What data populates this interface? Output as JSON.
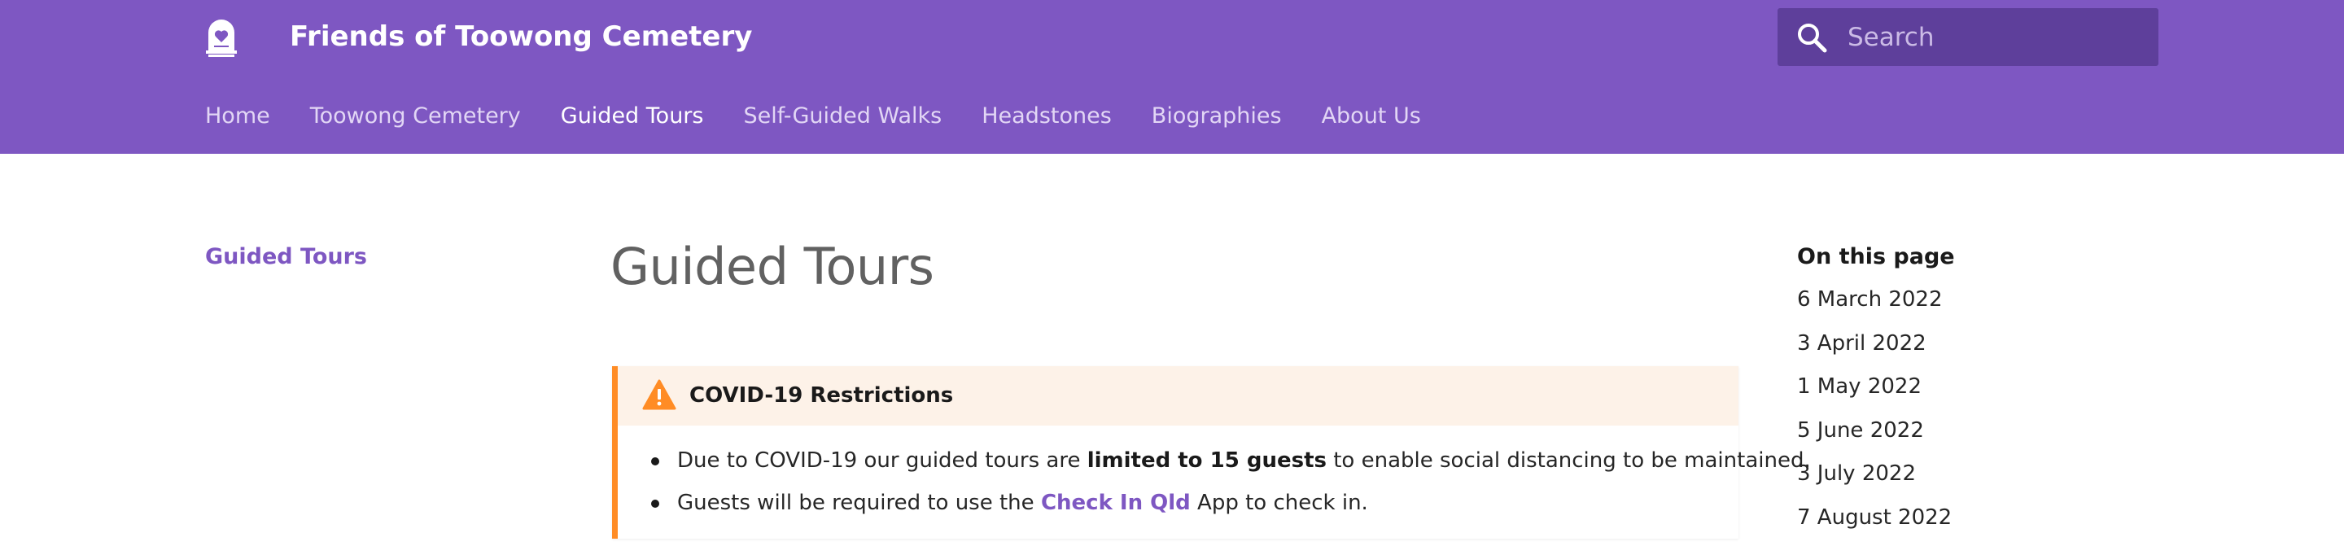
{
  "site": {
    "title": "Friends of Toowong Cemetery",
    "logo_icon": "headstone-heart-icon"
  },
  "search": {
    "placeholder": "Search",
    "value": "",
    "icon": "search-icon"
  },
  "nav": {
    "items": [
      {
        "label": "Home",
        "active": false
      },
      {
        "label": "Toowong Cemetery",
        "active": false
      },
      {
        "label": "Guided Tours",
        "active": true
      },
      {
        "label": "Self-Guided Walks",
        "active": false
      },
      {
        "label": "Headstones",
        "active": false
      },
      {
        "label": "Biographies",
        "active": false
      },
      {
        "label": "About Us",
        "active": false
      }
    ]
  },
  "sidebar": {
    "link": "Guided Tours"
  },
  "page": {
    "title": "Guided Tours"
  },
  "alert": {
    "title": "COVID-19 Restrictions",
    "icon": "warning-icon",
    "item1": {
      "pre": "Due to COVID-19 our guided tours are ",
      "bold": "limited to 15 guests",
      "post": " to enable social distancing to be maintained."
    },
    "item2": {
      "pre": "Guests will be required to use the ",
      "link": "Check In Qld",
      "post": " App to check in."
    }
  },
  "toc": {
    "title": "On this page",
    "items": [
      "6 March 2022",
      "3 April 2022",
      "1 May 2022",
      "5 June 2022",
      "3 July 2022",
      "7 August 2022"
    ]
  },
  "colors": {
    "brand": "#7e57c2",
    "brand_dark": "#5e3f9b",
    "warning": "#ff8c25",
    "alert_bg": "#fdf2e8"
  }
}
